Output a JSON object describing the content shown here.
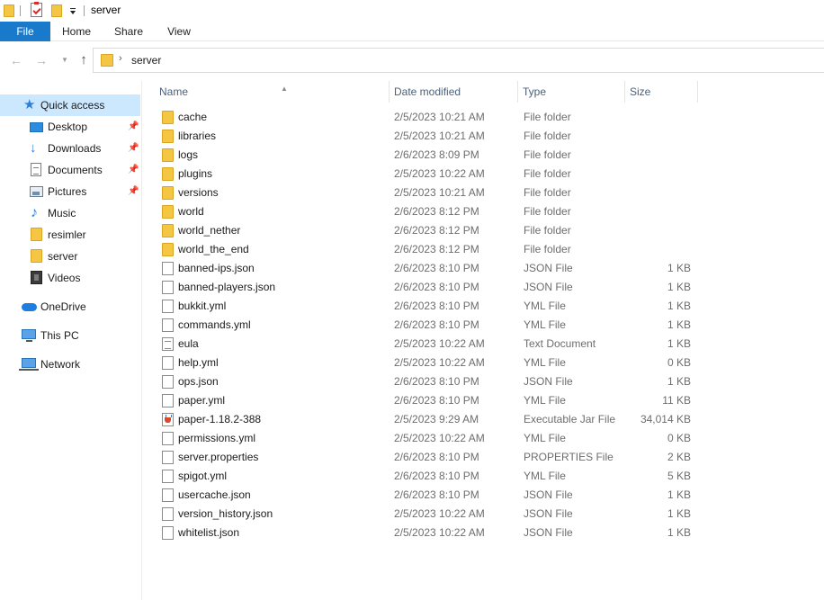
{
  "window": {
    "title": "server"
  },
  "quick_access_toolbar": {
    "icons": [
      "folder-icon",
      "properties-icon",
      "new-folder-icon",
      "customize-dropdown-icon"
    ]
  },
  "ribbon": {
    "tabs": [
      {
        "label": "File"
      },
      {
        "label": "Home"
      },
      {
        "label": "Share"
      },
      {
        "label": "View"
      }
    ]
  },
  "address": {
    "path": "server"
  },
  "navpane": {
    "items": [
      {
        "label": "Quick access",
        "icon": "star-icon",
        "selected": true
      },
      {
        "label": "Desktop",
        "icon": "desktop-icon",
        "pinned": true
      },
      {
        "label": "Downloads",
        "icon": "download-icon",
        "pinned": true
      },
      {
        "label": "Documents",
        "icon": "documents-icon",
        "pinned": true
      },
      {
        "label": "Pictures",
        "icon": "pictures-icon",
        "pinned": true
      },
      {
        "label": "Music",
        "icon": "music-icon"
      },
      {
        "label": "resimler",
        "icon": "folder-icon"
      },
      {
        "label": "server",
        "icon": "folder-icon"
      },
      {
        "label": "Videos",
        "icon": "videos-icon"
      },
      {
        "label": "OneDrive",
        "icon": "onedrive-icon"
      },
      {
        "label": "This PC",
        "icon": "this-pc-icon"
      },
      {
        "label": "Network",
        "icon": "network-icon"
      }
    ]
  },
  "columns": {
    "name": "Name",
    "date": "Date modified",
    "type": "Type",
    "size": "Size"
  },
  "files": [
    {
      "name": "cache",
      "date": "2/5/2023 10:21 AM",
      "type": "File folder",
      "size": "",
      "kind": "folder"
    },
    {
      "name": "libraries",
      "date": "2/5/2023 10:21 AM",
      "type": "File folder",
      "size": "",
      "kind": "folder"
    },
    {
      "name": "logs",
      "date": "2/6/2023 8:09 PM",
      "type": "File folder",
      "size": "",
      "kind": "folder"
    },
    {
      "name": "plugins",
      "date": "2/5/2023 10:22 AM",
      "type": "File folder",
      "size": "",
      "kind": "folder"
    },
    {
      "name": "versions",
      "date": "2/5/2023 10:21 AM",
      "type": "File folder",
      "size": "",
      "kind": "folder"
    },
    {
      "name": "world",
      "date": "2/6/2023 8:12 PM",
      "type": "File folder",
      "size": "",
      "kind": "folder"
    },
    {
      "name": "world_nether",
      "date": "2/6/2023 8:12 PM",
      "type": "File folder",
      "size": "",
      "kind": "folder"
    },
    {
      "name": "world_the_end",
      "date": "2/6/2023 8:12 PM",
      "type": "File folder",
      "size": "",
      "kind": "folder"
    },
    {
      "name": "banned-ips.json",
      "date": "2/6/2023 8:10 PM",
      "type": "JSON File",
      "size": "1 KB",
      "kind": "file"
    },
    {
      "name": "banned-players.json",
      "date": "2/6/2023 8:10 PM",
      "type": "JSON File",
      "size": "1 KB",
      "kind": "file"
    },
    {
      "name": "bukkit.yml",
      "date": "2/6/2023 8:10 PM",
      "type": "YML File",
      "size": "1 KB",
      "kind": "file"
    },
    {
      "name": "commands.yml",
      "date": "2/6/2023 8:10 PM",
      "type": "YML File",
      "size": "1 KB",
      "kind": "file"
    },
    {
      "name": "eula",
      "date": "2/5/2023 10:22 AM",
      "type": "Text Document",
      "size": "1 KB",
      "kind": "text"
    },
    {
      "name": "help.yml",
      "date": "2/5/2023 10:22 AM",
      "type": "YML File",
      "size": "0 KB",
      "kind": "file"
    },
    {
      "name": "ops.json",
      "date": "2/6/2023 8:10 PM",
      "type": "JSON File",
      "size": "1 KB",
      "kind": "file"
    },
    {
      "name": "paper.yml",
      "date": "2/6/2023 8:10 PM",
      "type": "YML File",
      "size": "11 KB",
      "kind": "file"
    },
    {
      "name": "paper-1.18.2-388",
      "date": "2/5/2023 9:29 AM",
      "type": "Executable Jar File",
      "size": "34,014 KB",
      "kind": "jar"
    },
    {
      "name": "permissions.yml",
      "date": "2/5/2023 10:22 AM",
      "type": "YML File",
      "size": "0 KB",
      "kind": "file"
    },
    {
      "name": "server.properties",
      "date": "2/6/2023 8:10 PM",
      "type": "PROPERTIES File",
      "size": "2 KB",
      "kind": "file"
    },
    {
      "name": "spigot.yml",
      "date": "2/6/2023 8:10 PM",
      "type": "YML File",
      "size": "5 KB",
      "kind": "file"
    },
    {
      "name": "usercache.json",
      "date": "2/6/2023 8:10 PM",
      "type": "JSON File",
      "size": "1 KB",
      "kind": "file"
    },
    {
      "name": "version_history.json",
      "date": "2/5/2023 10:22 AM",
      "type": "JSON File",
      "size": "1 KB",
      "kind": "file"
    },
    {
      "name": "whitelist.json",
      "date": "2/5/2023 10:22 AM",
      "type": "JSON File",
      "size": "1 KB",
      "kind": "file"
    }
  ],
  "colors": {
    "accent": "#1979ca",
    "selection": "#cce8ff",
    "folder": "#f5c544",
    "header_text": "#4c607a"
  }
}
